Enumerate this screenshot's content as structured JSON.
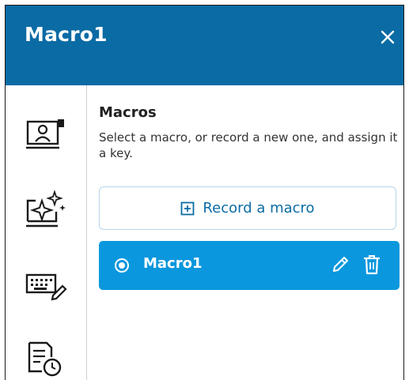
{
  "window": {
    "title": "Macro1",
    "close_icon": "close-icon"
  },
  "sidebar": {
    "items": [
      {
        "icon": "camera-profile-icon"
      },
      {
        "icon": "sparkle-effects-icon"
      },
      {
        "icon": "keyboard-edit-icon"
      },
      {
        "icon": "document-clock-icon"
      }
    ]
  },
  "macros": {
    "title": "Macros",
    "description": "Select a macro, or record a new one, and assign it a key.",
    "record_button": {
      "icon": "plus-square-icon",
      "label": "Record a macro"
    },
    "list": [
      {
        "name": "Macro1",
        "selected": true,
        "actions": [
          "edit-icon",
          "trash-icon"
        ]
      }
    ]
  },
  "colors": {
    "header": "#0b6ba4",
    "selected_item": "#0a97dd",
    "accent_text": "#0b6ba4"
  }
}
